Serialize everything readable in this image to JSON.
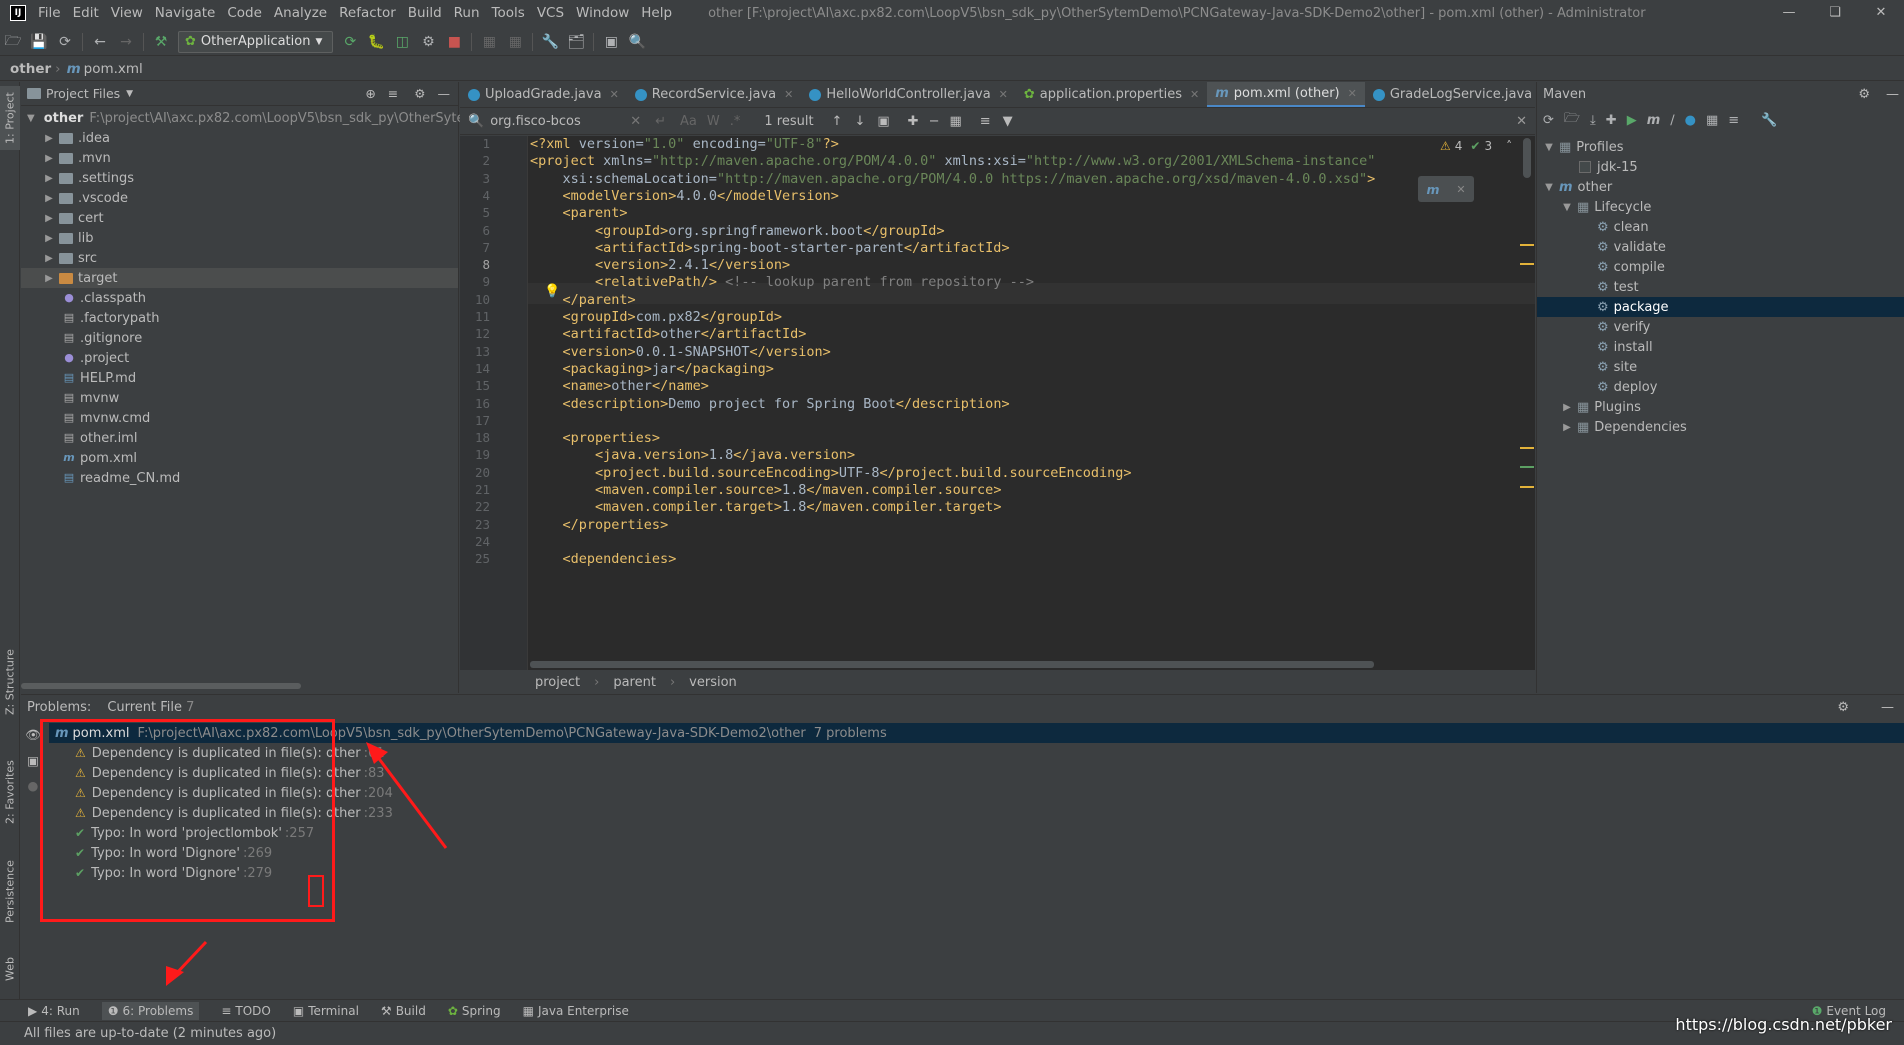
{
  "menubar": {
    "items": [
      "File",
      "Edit",
      "View",
      "Navigate",
      "Code",
      "Analyze",
      "Refactor",
      "Build",
      "Run",
      "Tools",
      "VCS",
      "Window",
      "Help"
    ],
    "title": "other [F:\\project\\AI\\axc.px82.com\\LoopV5\\bsn_sdk_py\\OtherSytemDemo\\PCNGateway-Java-SDK-Demo2\\other] - pom.xml (other) - Administrator"
  },
  "toolbar": {
    "run_config": "OtherApplication"
  },
  "navbar": {
    "project": "other",
    "file": "pom.xml"
  },
  "left_stripe": {
    "project_tab": "1: Project",
    "structure_tab": "Z: Structure",
    "favorites_tab": "2: Favorites",
    "persistence_tab": "Persistence",
    "web_tab": "Web"
  },
  "project_panel": {
    "title": "Project Files",
    "root": {
      "name": "other",
      "path": "F:\\project\\AI\\axc.px82.com\\LoopV5\\bsn_sdk_py\\OtherSytemD"
    },
    "folders": [
      ".idea",
      ".mvn",
      ".settings",
      ".vscode",
      "cert",
      "lib",
      "src",
      "target"
    ],
    "files": [
      ".classpath",
      ".factorypath",
      ".gitignore",
      ".project",
      "HELP.md",
      "mvnw",
      "mvnw.cmd",
      "other.iml",
      "pom.xml",
      "readme_CN.md"
    ]
  },
  "editor": {
    "tabs": [
      "UploadGrade.java",
      "RecordService.java",
      "HelloWorldController.java",
      "application.properties",
      "pom.xml (other)",
      "GradeLogService.java",
      "G"
    ],
    "find": {
      "query": "org.fisco-bcos",
      "result": "1 result"
    },
    "inspection": {
      "warnings": "4",
      "typos": "3"
    },
    "line_numbers": [
      "1",
      "2",
      "3",
      "4",
      "5",
      "6",
      "7",
      "8",
      "9",
      "10",
      "11",
      "12",
      "13",
      "14",
      "15",
      "16",
      "17",
      "18",
      "19",
      "20",
      "21",
      "22",
      "23",
      "24",
      "25"
    ],
    "lines": [
      "<?xml version=\"1.0\" encoding=\"UTF-8\"?>",
      "<project xmlns=\"http://maven.apache.org/POM/4.0.0\" xmlns:xsi=\"http://www.w3.org/2001/XMLSchema-instance\"",
      "    xsi:schemaLocation=\"http://maven.apache.org/POM/4.0.0 https://maven.apache.org/xsd/maven-4.0.0.xsd\">",
      "    <modelVersion>4.0.0</modelVersion>",
      "    <parent>",
      "        <groupId>org.springframework.boot</groupId>",
      "        <artifactId>spring-boot-starter-parent</artifactId>",
      "        <version>2.4.1</version>",
      "        <relativePath/> <!-- lookup parent from repository -->",
      "    </parent>",
      "    <groupId>com.px82</groupId>",
      "    <artifactId>other</artifactId>",
      "    <version>0.0.1-SNAPSHOT</version>",
      "    <packaging>jar</packaging>",
      "    <name>other</name>",
      "    <description>Demo project for Spring Boot</description>",
      "",
      "    <properties>",
      "        <java.version>1.8</java.version>",
      "        <project.build.sourceEncoding>UTF-8</project.build.sourceEncoding>",
      "        <maven.compiler.source>1.8</maven.compiler.source>",
      "        <maven.compiler.target>1.8</maven.compiler.target>",
      "    </properties>",
      "",
      "    <dependencies>"
    ],
    "breadcrumb": [
      "project",
      "parent",
      "version"
    ]
  },
  "maven": {
    "title": "Maven",
    "profiles_label": "Profiles",
    "profile": "jdk-15",
    "project": "other",
    "lifecycle_label": "Lifecycle",
    "lifecycle": [
      "clean",
      "validate",
      "compile",
      "test",
      "package",
      "verify",
      "install",
      "site",
      "deploy"
    ],
    "selected": "package",
    "plugins_label": "Plugins",
    "dependencies_label": "Dependencies"
  },
  "problems": {
    "label": "Problems:",
    "scope": "Current File",
    "count": "7",
    "file": "pom.xml",
    "file_path": "F:\\project\\AI\\axc.px82.com\\LoopV5\\bsn_sdk_py\\OtherSytemDemo\\PCNGateway-Java-SDK-Demo2\\other",
    "summary": "7 problems",
    "items": [
      {
        "kind": "warning",
        "text": "Dependency is duplicated in file(s): other",
        "loc": ":61"
      },
      {
        "kind": "warning",
        "text": "Dependency is duplicated in file(s): other",
        "loc": ":83"
      },
      {
        "kind": "warning",
        "text": "Dependency is duplicated in file(s): other",
        "loc": ":204"
      },
      {
        "kind": "warning",
        "text": "Dependency is duplicated in file(s): other",
        "loc": ":233"
      },
      {
        "kind": "typo",
        "text": "Typo: In word 'projectlombok'",
        "loc": ":257"
      },
      {
        "kind": "typo",
        "text": "Typo: In word 'Dignore'",
        "loc": ":269"
      },
      {
        "kind": "typo",
        "text": "Typo: In word 'Dignore'",
        "loc": ":279"
      }
    ]
  },
  "bottom_tools": [
    "4: Run",
    "6: Problems",
    "TODO",
    "Terminal",
    "Build",
    "Spring",
    "Java Enterprise"
  ],
  "event_log": "Event Log",
  "status": "All files are up-to-date (2 minutes ago)",
  "watermark": "https://blog.csdn.net/pbker",
  "colors": {
    "accent": "#4a88c7",
    "warning": "#e2b23a",
    "typo": "#5ca063",
    "annotation": "#ff1a1a"
  }
}
